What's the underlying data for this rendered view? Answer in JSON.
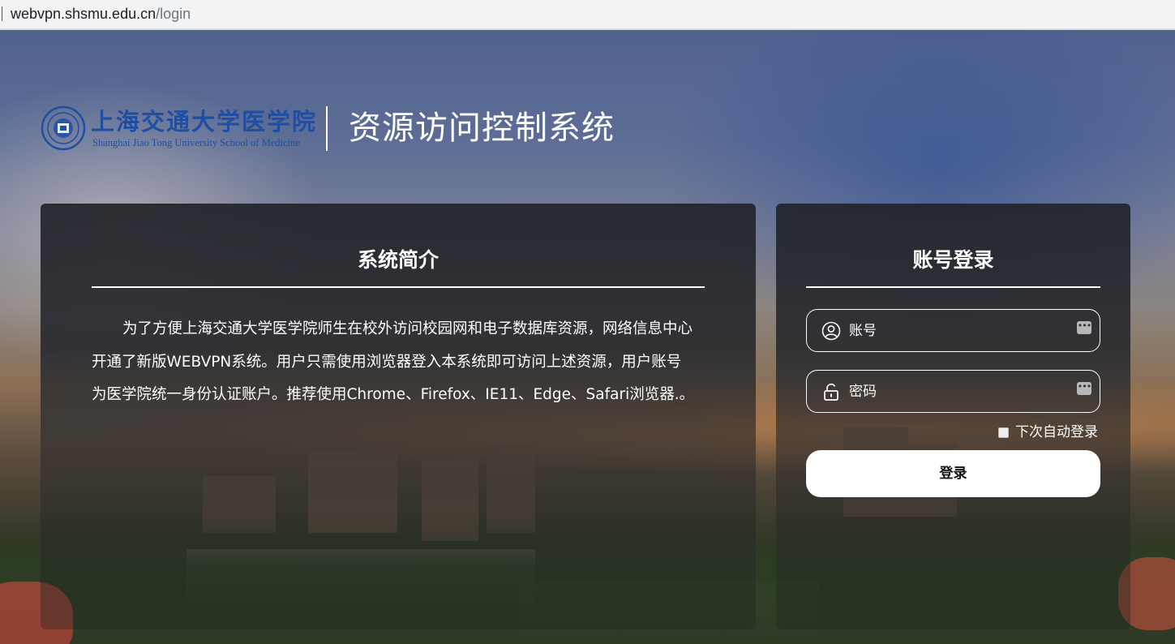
{
  "browser": {
    "url_host": "webvpn.shsmu.edu.cn",
    "url_path": "/login"
  },
  "header": {
    "logo_cn": "上海交通大学医学院",
    "logo_en": "Shanghai Jiao Tong University School of Medicine",
    "system_title": "资源访问控制系统"
  },
  "intro": {
    "heading": "系统简介",
    "body": "为了方便上海交通大学医学院师生在校外访问校园网和电子数据库资源，网络信息中心开通了新版WEBVPN系统。用户只需使用浏览器登入本系统即可访问上述资源，用户账号为医学院统一身份认证账户。推荐使用Chrome、Firefox、IE11、Edge、Safari浏览器.。"
  },
  "login": {
    "heading": "账号登录",
    "username_placeholder": "账号",
    "password_placeholder": "密码",
    "remember_label": "下次自动登录",
    "remember_checked": false,
    "submit_label": "登录"
  },
  "icons": {
    "user": "user-icon",
    "lock": "lock-icon",
    "autofill": "password-manager-key-icon"
  },
  "colors": {
    "logo_blue": "#1e4fa3",
    "text": "#ffffff",
    "button_bg": "#ffffff"
  }
}
